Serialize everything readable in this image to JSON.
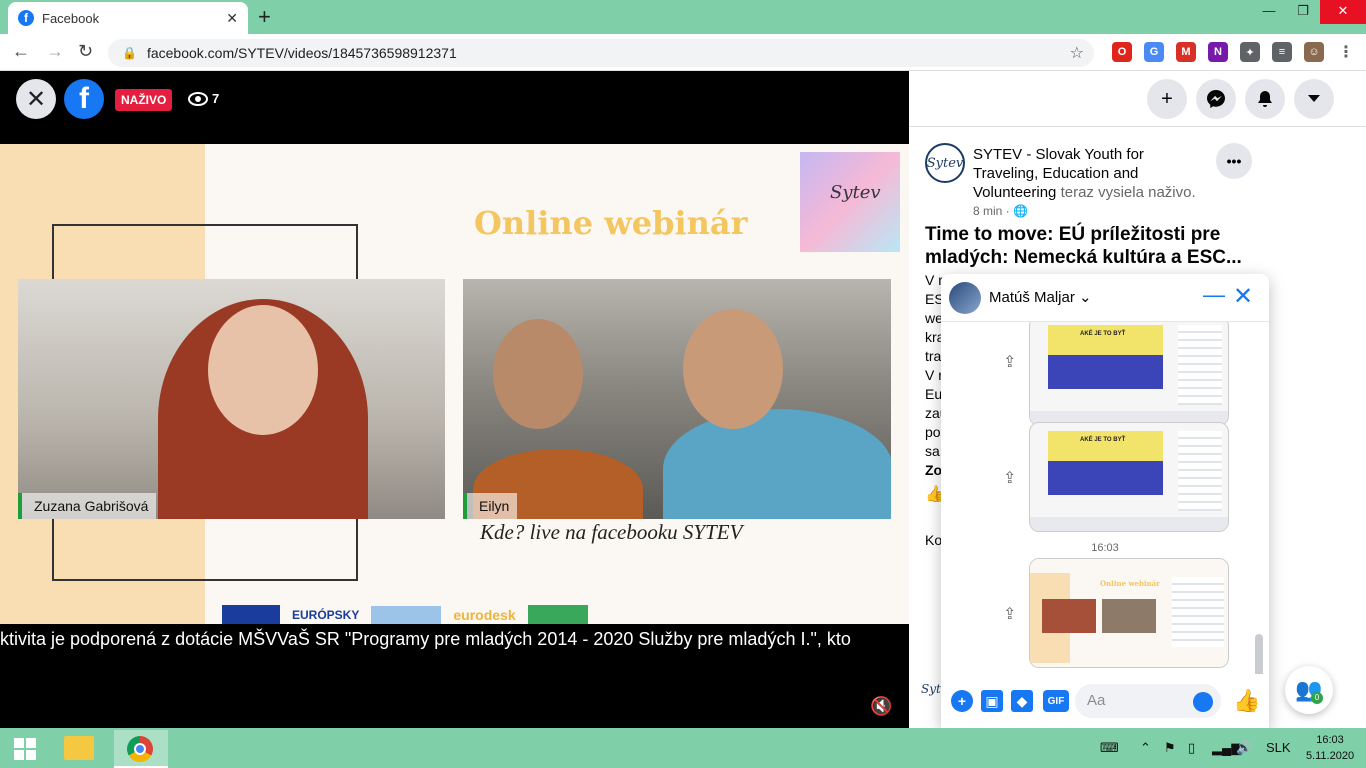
{
  "browser": {
    "tab_title": "Facebook",
    "tab_favicon": "f",
    "tab_close": "✕",
    "new_tab": "+",
    "url": "facebook.com/SYTEV/videos/1845736598912371",
    "extensions": [
      {
        "name": "opera-icon",
        "glyph": "O",
        "color": "#e0261b"
      },
      {
        "name": "translate-icon",
        "glyph": "G",
        "color": "#4a8af4"
      },
      {
        "name": "gmail-icon",
        "glyph": "M",
        "color": "#d93025"
      },
      {
        "name": "onenote-icon",
        "glyph": "N",
        "color": "#7719aa"
      },
      {
        "name": "puzzle-icon",
        "glyph": "✦",
        "color": "#5f6368"
      },
      {
        "name": "playlist-icon",
        "glyph": "≡",
        "color": "#5f6368"
      },
      {
        "name": "profile-avatar",
        "glyph": "☺",
        "color": "#8a6a4e"
      }
    ]
  },
  "video": {
    "live_label": "NAŽIVO",
    "viewer_count": "7",
    "slide_title": "Online webinár",
    "slide_where": "Kde? live na facebooku SYTEV",
    "logo_card_text": "Sytev",
    "eu_label": "EURÓPSKY",
    "eurodesk_label": "eurodesk",
    "participants": [
      {
        "name": "Zuzana Gabrišová"
      },
      {
        "name": "Eilyn"
      }
    ],
    "ticker": "ktivita je podporená z dotácie MŠVVaŠ SR \"Programy pre mladých 2014 - 2020 Služby pre mladých I.\", kto"
  },
  "post": {
    "author": "SYTEV - Slovak Youth for Traveling, Education and Volunteering",
    "status": "teraz vysiela naživo.",
    "time": "8 min · 🌐",
    "title": "Time to move: EÚ príležitosti pre mladých: Nemecká kultúra a ESC...",
    "text_lines": [
      "V r",
      "ES",
      "we",
      "kra",
      "tra",
      "V r",
      "Eu",
      "zau",
      "po",
      "sa",
      "Zo"
    ],
    "comments_label": "Ko",
    "avatar_text": "Sytev"
  },
  "messenger": {
    "contact_name": "Matúš Maljar",
    "time_divider": "16:03",
    "shot_title": "AKÉ JE TO BYŤ",
    "shot_webinar": "Online webinár",
    "input_placeholder": "Aa",
    "gif_label": "GIF"
  },
  "taskbar": {
    "language": "SLK",
    "time": "16:03",
    "date": "5.11.2020"
  }
}
